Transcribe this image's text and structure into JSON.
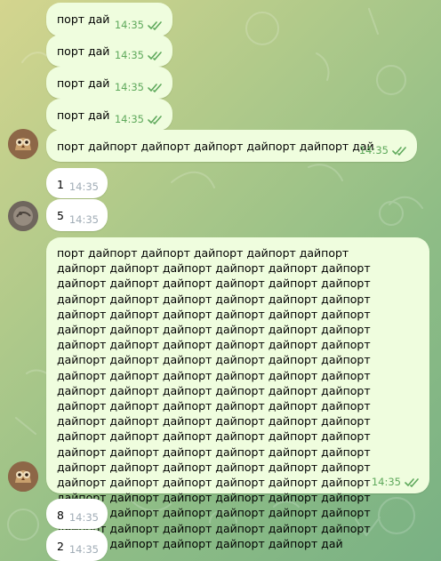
{
  "colors": {
    "outgoing_bubble": "#effdde",
    "incoming_bubble": "#ffffff",
    "outgoing_meta": "#5fa95c",
    "incoming_meta": "#a0acb6"
  },
  "messages": [
    {
      "direction": "out",
      "text": "порт дай",
      "time": "14:35",
      "status": "read"
    },
    {
      "direction": "out",
      "text": "порт дай",
      "time": "14:35",
      "status": "read"
    },
    {
      "direction": "out",
      "text": "порт дай",
      "time": "14:35",
      "status": "read"
    },
    {
      "direction": "out",
      "text": "порт дай",
      "time": "14:35",
      "status": "read"
    },
    {
      "direction": "out",
      "text": "порт дайпорт дайпорт дайпорт дайпорт дайпорт дай",
      "time": "14:35",
      "status": "read",
      "avatar": "owl-avatar"
    },
    {
      "direction": "in",
      "text": "1",
      "time": "14:35"
    },
    {
      "direction": "in",
      "text": "5",
      "time": "14:35",
      "avatar": "coin-avatar"
    },
    {
      "direction": "out",
      "text": "порт дайпорт дайпорт дайпорт дайпорт дайпорт дайпорт дайпорт дайпорт дайпорт дайпорт дайпорт дайпорт дайпорт дайпорт дайпорт дайпорт дайпорт дайпорт дайпорт дайпорт дайпорт дайпорт дайпорт дайпорт дайпорт дайпорт дайпорт дайпорт дайпорт дайпорт дайпорт дайпорт дайпорт дайпорт дайпорт дайпорт дайпорт дайпорт дайпорт дайпорт дайпорт дайпорт дайпорт дайпорт дайпорт дайпорт дайпорт дайпорт дайпорт дайпорт дайпорт дайпорт дайпорт дайпорт дайпорт дайпорт дайпорт дайпорт дайпорт дайпорт дайпорт дайпорт дайпорт дайпорт дайпорт дайпорт дайпорт дайпорт дайпорт дайпорт дайпорт дайпорт дайпорт дайпорт дайпорт дайпорт дайпорт дайпорт дайпорт дайпорт дайпорт дайпорт дайпорт дайпорт дайпорт дайпорт дайпорт дайпорт дайпорт дайпорт дайпорт дайпорт дайпорт дайпорт дайпорт дайпорт дайпорт дайпорт дайпорт дайпорт дайпорт дайпорт дайпорт дайпорт дайпорт дайпорт дайпорт дайпорт дайпорт дайпорт дайпорт дайпорт дайпорт дайпорт дайпорт дайпорт дайпорт дайпорт дай",
      "time": "14:35",
      "status": "read",
      "avatar": "owl-avatar"
    },
    {
      "direction": "in",
      "text": "8",
      "time": "14:35"
    },
    {
      "direction": "in",
      "text": "2",
      "time": "14:35"
    }
  ]
}
